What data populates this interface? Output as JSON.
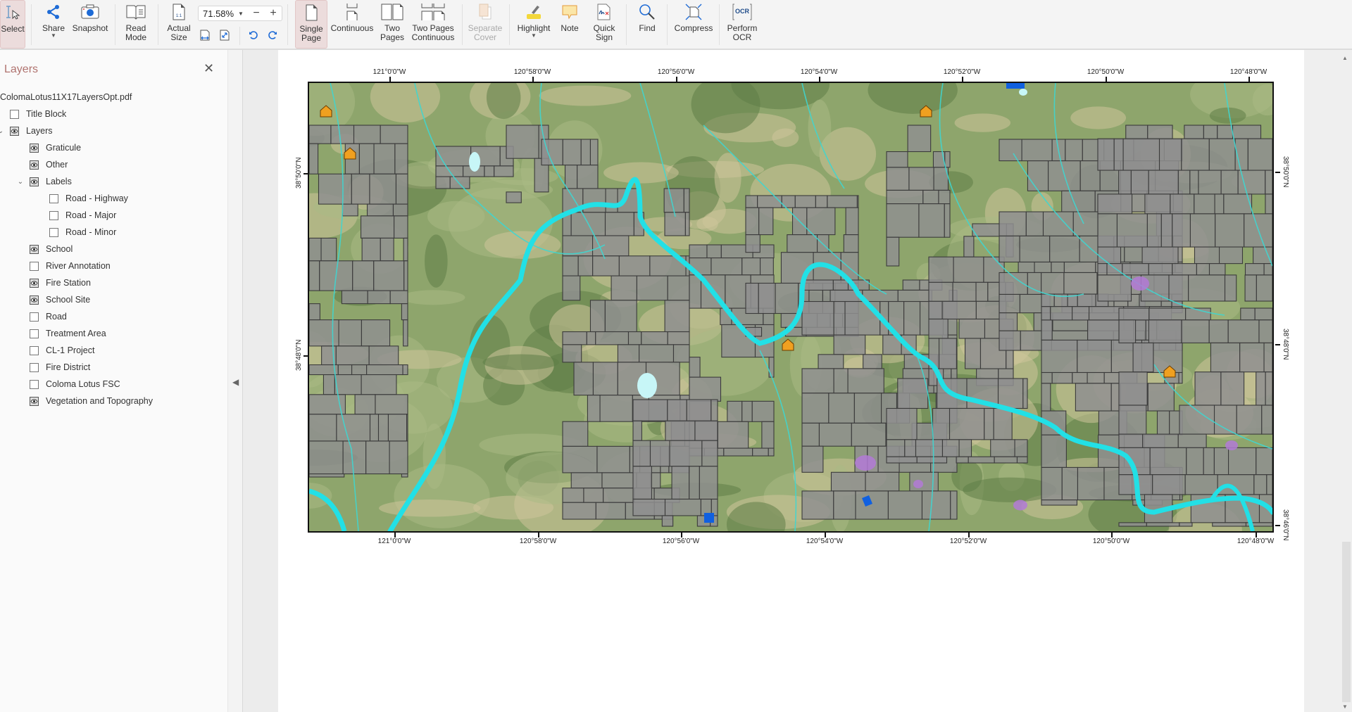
{
  "toolbar": {
    "select": "Select",
    "share": "Share",
    "snapshot": "Snapshot",
    "read_mode": "Read\nMode",
    "actual_size": "Actual\nSize",
    "zoom_value": "71.58%",
    "zoom_minus": "−",
    "zoom_plus": "+",
    "single_page": "Single\nPage",
    "continuous": "Continuous",
    "two_pages": "Two\nPages",
    "two_pages_continuous": "Two Pages\nContinuous",
    "separate_cover": "Separate\nCover",
    "highlight": "Highlight",
    "note": "Note",
    "quick_sign": "Quick\nSign",
    "find": "Find",
    "compress": "Compress",
    "perform_ocr": "Perform\nOCR",
    "actual_size_icon_text": "1:1",
    "ocr_icon_text": "OCR"
  },
  "layers_panel": {
    "title": "Layers",
    "close": "✕",
    "file": "ColomaLotus11X17LayersOpt.pdf",
    "items": [
      {
        "label": "Title Block",
        "visible": false,
        "level": 1,
        "expandable": false
      },
      {
        "label": "Layers",
        "visible": true,
        "level": 1,
        "expandable": true,
        "expanded": true
      },
      {
        "label": "Graticule",
        "visible": true,
        "level": 2,
        "expandable": false
      },
      {
        "label": "Other",
        "visible": true,
        "level": 2,
        "expandable": false
      },
      {
        "label": "Labels",
        "visible": true,
        "level": 2,
        "expandable": true,
        "expanded": true
      },
      {
        "label": "Road - Highway",
        "visible": false,
        "level": 3,
        "expandable": false
      },
      {
        "label": "Road - Major",
        "visible": false,
        "level": 3,
        "expandable": false
      },
      {
        "label": "Road - Minor",
        "visible": false,
        "level": 3,
        "expandable": false
      },
      {
        "label": "School",
        "visible": true,
        "level": 2,
        "expandable": false
      },
      {
        "label": "River Annotation",
        "visible": false,
        "level": 2,
        "expandable": false
      },
      {
        "label": "Fire Station",
        "visible": true,
        "level": 2,
        "expandable": false
      },
      {
        "label": "School Site",
        "visible": true,
        "level": 2,
        "expandable": false
      },
      {
        "label": "Road",
        "visible": false,
        "level": 2,
        "expandable": false
      },
      {
        "label": "Treatment Area",
        "visible": false,
        "level": 2,
        "expandable": false
      },
      {
        "label": "CL-1 Project",
        "visible": false,
        "level": 2,
        "expandable": false
      },
      {
        "label": "Fire District",
        "visible": false,
        "level": 2,
        "expandable": false
      },
      {
        "label": "Coloma Lotus FSC",
        "visible": false,
        "level": 2,
        "expandable": false
      },
      {
        "label": "Vegetation and Topography",
        "visible": true,
        "level": 2,
        "expandable": false
      }
    ]
  },
  "map": {
    "lon_labels": [
      "121°0'0\"W",
      "120°58'0\"W",
      "120°56'0\"W",
      "120°54'0\"W",
      "120°52'0\"W",
      "120°50'0\"W",
      "120°48'0\"W"
    ],
    "lat_labels": [
      "38°50'0\"N",
      "38°48'0\"N",
      "38°46'0\"N"
    ],
    "colors": {
      "river": "#22e0e6",
      "parcel": "#8f8f8f",
      "parcel_stroke": "#3b3b3b",
      "terrain": "#8ea56c",
      "terrain_light": "#cdc49a",
      "terrain_dark": "#5e7d47",
      "treatment": "#b37ad6",
      "fire_station": "#f0a020",
      "school_site": "#1060e0"
    }
  }
}
